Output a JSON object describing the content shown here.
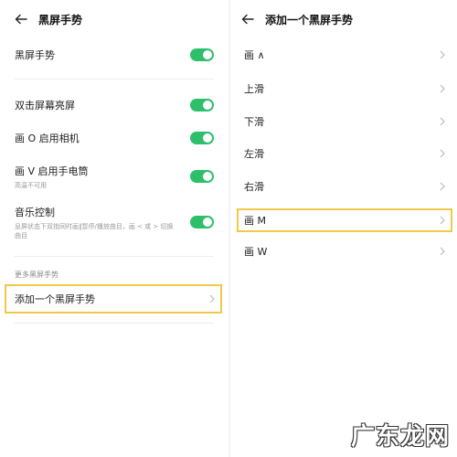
{
  "left": {
    "title": "黑屏手势",
    "main_toggle": {
      "label": "黑屏手势",
      "on": true
    },
    "toggles": [
      {
        "label": "双击屏幕亮屏",
        "sub": "",
        "on": true
      },
      {
        "label": "画 O 启用相机",
        "sub": "",
        "on": true
      },
      {
        "label": "画 V 启用手电筒",
        "sub": "高温不可用",
        "on": true
      },
      {
        "label": "音乐控制",
        "sub": "息屏状态下双指同时画‖暂停/播放曲目，画 < 或 > 切换曲目",
        "on": true
      }
    ],
    "section_label": "更多黑屏手势",
    "add_gesture_label": "添加一个黑屏手势"
  },
  "right": {
    "title": "添加一个黑屏手势",
    "items": [
      "画 ∧",
      "上滑",
      "下滑",
      "左滑",
      "右滑",
      "画 M",
      "画 W"
    ],
    "highlighted_item": "画 M"
  },
  "colors": {
    "toggle_on": "#2ebf6b",
    "highlight": "#f2c84b"
  },
  "watermark": "广东龙网"
}
